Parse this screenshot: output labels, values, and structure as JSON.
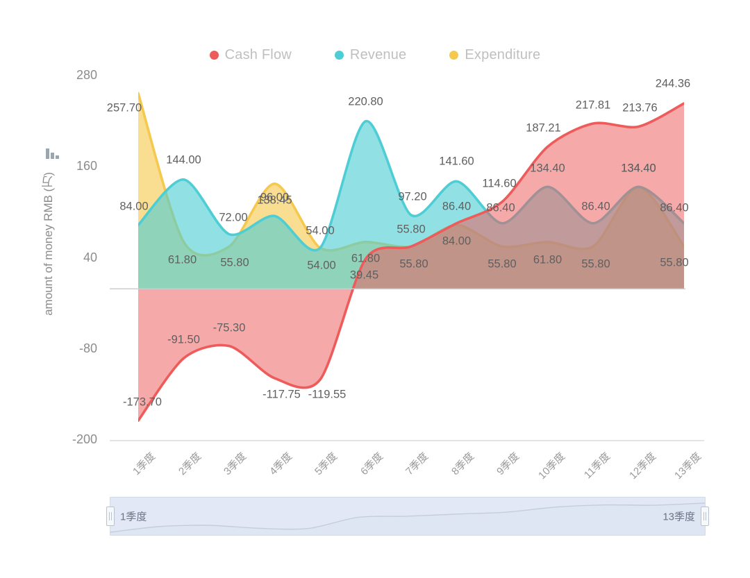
{
  "chart_data": {
    "type": "area",
    "title": "",
    "xlabel": "",
    "ylabel": "amount of money RMB (万)",
    "categories": [
      "1季度",
      "2季度",
      "3季度",
      "4季度",
      "5季度",
      "6季度",
      "7季度",
      "8季度",
      "9季度",
      "10季度",
      "11季度",
      "12季度",
      "13季度"
    ],
    "ylim": [
      -200,
      280
    ],
    "yticks": [
      280,
      160,
      40,
      -80,
      -200
    ],
    "grid": false,
    "legend_position": "top-center",
    "smooth": true,
    "series": [
      {
        "name": "Cash Flow",
        "color": "#ee5b5b",
        "values": [
          -173.7,
          -91.5,
          -75.3,
          -117.75,
          -119.55,
          39.45,
          55.8,
          86.4,
          114.6,
          187.21,
          217.81,
          213.76,
          244.36
        ],
        "labels": [
          "-173.70",
          "-91.50",
          "-75.30",
          "-117.75",
          "-119.55",
          "39.45",
          "55.80",
          "86.40",
          "114.60",
          "187.21",
          "217.81",
          "213.76",
          "244.36"
        ]
      },
      {
        "name": "Revenue",
        "color": "#4ecdd4",
        "values": [
          84.0,
          144.0,
          72.0,
          96.0,
          54.0,
          220.8,
          97.2,
          141.6,
          86.4,
          134.4,
          86.4,
          134.4,
          86.4
        ],
        "labels": [
          "84.00",
          "144.00",
          "72.00",
          "96.00",
          "54.00",
          "220.80",
          "97.20",
          "141.60",
          "86.40",
          "134.40",
          "86.40",
          "134.40",
          "86.40"
        ]
      },
      {
        "name": "Expenditure",
        "color": "#f5c94e",
        "values": [
          257.7,
          61.8,
          55.8,
          138.45,
          54.0,
          61.8,
          55.8,
          84.0,
          55.8,
          61.8,
          55.8,
          134.4,
          55.8
        ],
        "labels": [
          "257.70",
          "61.80",
          "55.80",
          "138.45",
          "54.00",
          "61.80",
          "55.80",
          "84.00",
          "55.80",
          "61.80",
          "55.80",
          "134.40",
          "55.80"
        ]
      }
    ],
    "label_overrides": {
      "Cash Flow": [
        {
          "i": 0,
          "dx": 6,
          "dy": -26
        },
        {
          "i": 1,
          "dx": 0,
          "dy": -26
        },
        {
          "i": 2,
          "dx": 0,
          "dy": -26
        },
        {
          "i": 3,
          "dx": 10,
          "dy": 24
        },
        {
          "i": 4,
          "dx": 10,
          "dy": 22
        },
        {
          "i": 5,
          "dx": -2,
          "dy": 24
        },
        {
          "i": 6,
          "dx": 0,
          "dy": -24
        },
        {
          "i": 7,
          "dx": 0,
          "dy": -24
        },
        {
          "i": 8,
          "dx": -4,
          "dy": -26
        },
        {
          "i": 9,
          "dx": -6,
          "dy": -26
        },
        {
          "i": 10,
          "dx": 0,
          "dy": -26
        },
        {
          "i": 11,
          "dx": 2,
          "dy": -26
        },
        {
          "i": 12,
          "dx": -16,
          "dy": -28
        }
      ],
      "Revenue": [
        {
          "i": 0,
          "dx": -6,
          "dy": -26
        },
        {
          "i": 1,
          "dx": 0,
          "dy": -28
        },
        {
          "i": 2,
          "dx": 6,
          "dy": -24
        },
        {
          "i": 3,
          "dx": 0,
          "dy": -26
        },
        {
          "i": 4,
          "dx": 0,
          "dy": -24
        },
        {
          "i": 5,
          "dx": 0,
          "dy": -28
        },
        {
          "i": 6,
          "dx": 2,
          "dy": -26
        },
        {
          "i": 7,
          "dx": 0,
          "dy": -28
        },
        {
          "i": 8,
          "dx": -2,
          "dy": -22
        },
        {
          "i": 9,
          "dx": 0,
          "dy": -26
        },
        {
          "i": 10,
          "dx": 4,
          "dy": -24
        },
        {
          "i": 11,
          "dx": 0,
          "dy": -26
        },
        {
          "i": 12,
          "dx": -14,
          "dy": -22
        }
      ],
      "Expenditure": [
        {
          "i": 0,
          "dx": -20,
          "dy": 22
        },
        {
          "i": 1,
          "dx": -2,
          "dy": 26
        },
        {
          "i": 2,
          "dx": 8,
          "dy": 24
        },
        {
          "i": 3,
          "dx": 0,
          "dy": 24
        },
        {
          "i": 4,
          "dx": 2,
          "dy": 26
        },
        {
          "i": 5,
          "dx": 0,
          "dy": 24
        },
        {
          "i": 6,
          "dx": 4,
          "dy": 26
        },
        {
          "i": 7,
          "dx": 0,
          "dy": 24
        },
        {
          "i": 8,
          "dx": 0,
          "dy": 26
        },
        {
          "i": 9,
          "dx": 0,
          "dy": 26
        },
        {
          "i": 10,
          "dx": 4,
          "dy": 26
        },
        {
          "i": 11,
          "dx": 0,
          "dy": -26
        },
        {
          "i": 12,
          "dx": -14,
          "dy": 24
        }
      ]
    }
  },
  "legend": {
    "items": [
      {
        "label": "Cash Flow",
        "color": "#ee5b5b"
      },
      {
        "label": "Revenue",
        "color": "#4ecdd4"
      },
      {
        "label": "Expenditure",
        "color": "#f5c94e"
      }
    ]
  },
  "toolbox": {
    "icon": "bar-chart-icon"
  },
  "datazoom": {
    "start_label": "1季度",
    "end_label": "13季度",
    "handle_icon": "drag-handle-icon"
  },
  "colors": {
    "axis_line": "#cccccc",
    "tick_text": "#8c8c8c",
    "label_text": "#5f5f5f",
    "legend_text": "#bfbfbf",
    "background": "#ffffff"
  }
}
